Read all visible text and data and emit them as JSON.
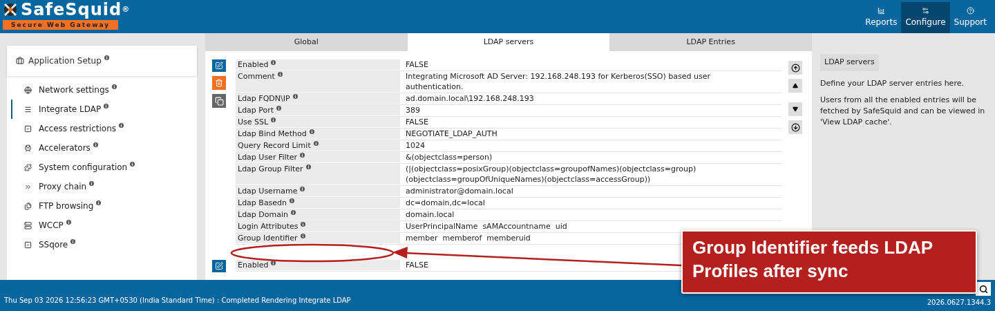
{
  "header": {
    "logo": {
      "name": "SafeSquid",
      "mark": "®",
      "tagline": "Secure Web Gateway"
    },
    "nav": [
      {
        "label": "Reports",
        "selected": false
      },
      {
        "label": "Configure",
        "selected": true
      },
      {
        "label": "Support",
        "selected": false
      }
    ]
  },
  "sidebar": {
    "section": {
      "title": "Application Setup"
    },
    "items": [
      {
        "label": "Network settings",
        "selected": false
      },
      {
        "label": "Integrate LDAP",
        "selected": true
      },
      {
        "label": "Access restrictions",
        "selected": false
      },
      {
        "label": "Accelerators",
        "selected": false
      },
      {
        "label": "System configuration",
        "selected": false
      },
      {
        "label": "Proxy chain",
        "selected": false
      },
      {
        "label": "FTP browsing",
        "selected": false
      },
      {
        "label": "WCCP",
        "selected": false
      },
      {
        "label": "SSqore",
        "selected": false
      }
    ]
  },
  "tabs": [
    {
      "label": "Global",
      "selected": false
    },
    {
      "label": "LDAP servers",
      "selected": true
    },
    {
      "label": "LDAP Entries",
      "selected": false
    }
  ],
  "entries": [
    {
      "fields": [
        {
          "label": "Enabled",
          "value": "FALSE"
        },
        {
          "label": "Comment",
          "value": "Integrating Microsoft AD Server: 192.168.248.193 for Kerberos(SSO) based user authentication."
        },
        {
          "label": "Ldap FQDN\\IP",
          "value": "ad.domain.local\\192.168.248.193"
        },
        {
          "label": "Ldap Port",
          "value": "389"
        },
        {
          "label": "Use SSL",
          "value": "FALSE"
        },
        {
          "label": "Ldap Bind Method",
          "value": "NEGOTIATE_LDAP_AUTH"
        },
        {
          "label": "Query Record Limit",
          "value": "1024"
        },
        {
          "label": "Ldap User Filter",
          "value": "&(objectclass=person)"
        },
        {
          "label": "Ldap Group Filter",
          "value": "(|(objectclass=posixGroup)(objectclass=groupofNames)(objectclass=group)(objectclass=groupOfUniqueNames)(objectclass=accessGroup))"
        },
        {
          "label": "Ldap Username",
          "value": "administrator@domain.local"
        },
        {
          "label": "Ldap Basedn",
          "value": "dc=domain,dc=local"
        },
        {
          "label": "Ldap Domain",
          "value": "domain.local"
        },
        {
          "label": "Login Attributes",
          "value": "UserPrincipalName  sAMAccountname  uid"
        },
        {
          "label": "Group Identifier",
          "value": "member  memberof  memberuid"
        }
      ]
    },
    {
      "fields": [
        {
          "label": "Enabled",
          "value": "FALSE"
        }
      ]
    }
  ],
  "side_panel": {
    "title": "LDAP servers",
    "paragraphs": [
      "Define your LDAP server entries here.",
      "Users from all the enabled entries will be fetched by SafeSquid and can be viewed in 'View LDAP cache'."
    ]
  },
  "annotation": {
    "text": "Group Identifier feeds LDAP Profiles after sync"
  },
  "status_bar": {
    "message": "Thu Sep 03 2026 12:56:23 GMT+0530 (India Standard Time) : Completed Rendering Integrate LDAP",
    "version": "2026.0627.1344.3"
  }
}
